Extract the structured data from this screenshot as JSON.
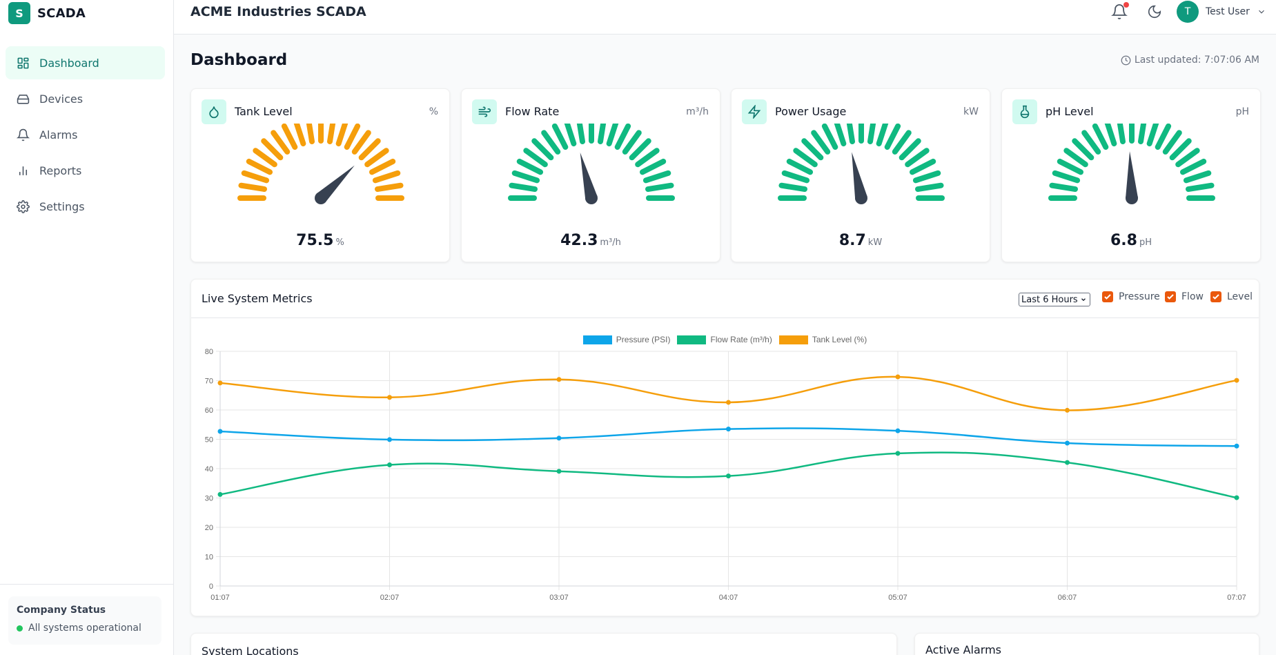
{
  "brand": {
    "logo_letter": "S",
    "name": "SCADA"
  },
  "header": {
    "title": "ACME Industries SCADA",
    "user_initial": "T",
    "user_name": "Test User"
  },
  "sidebar": {
    "items": [
      {
        "label": "Dashboard",
        "icon": "grid-icon",
        "active": true
      },
      {
        "label": "Devices",
        "icon": "hard-drive-icon"
      },
      {
        "label": "Alarms",
        "icon": "bell-icon"
      },
      {
        "label": "Reports",
        "icon": "bar-chart-icon"
      },
      {
        "label": "Settings",
        "icon": "gear-icon"
      }
    ],
    "company_status": {
      "title": "Company Status",
      "text": "All systems operational"
    }
  },
  "page": {
    "title": "Dashboard",
    "last_updated": "Last updated: 7:07:06 AM"
  },
  "gauges": [
    {
      "title": "Tank Level",
      "unit_label": "%",
      "value": "75.5",
      "value_unit": "%",
      "fraction": 0.755,
      "color": "#f59e0b",
      "icon": "droplet-icon"
    },
    {
      "title": "Flow Rate",
      "unit_label": "m³/h",
      "value": "42.3",
      "value_unit": "m³/h",
      "fraction": 0.423,
      "color": "#10b981",
      "icon": "wind-icon"
    },
    {
      "title": "Power Usage",
      "unit_label": "kW",
      "value": "8.7",
      "value_unit": "kW",
      "fraction": 0.435,
      "color": "#10b981",
      "icon": "zap-icon"
    },
    {
      "title": "pH Level",
      "unit_label": "pH",
      "value": "6.8",
      "value_unit": "pH",
      "fraction": 0.486,
      "color": "#10b981",
      "icon": "flask-icon"
    }
  ],
  "metrics": {
    "title": "Live System Metrics",
    "range_selected": "Last 6 Hours",
    "toggles": [
      "Pressure",
      "Flow",
      "Level"
    ]
  },
  "chart_data": {
    "type": "line",
    "x": [
      "01:07",
      "02:07",
      "03:07",
      "04:07",
      "05:07",
      "06:07",
      "07:07"
    ],
    "ylim": [
      0,
      80
    ],
    "yticks": [
      "0",
      "10",
      "20",
      "30",
      "40",
      "50",
      "60",
      "70",
      "80"
    ],
    "grid": true,
    "legend_position": "top",
    "series": [
      {
        "name": "Pressure (PSI)",
        "color": "#0ea5e9",
        "values": [
          52.7,
          49.9,
          50.4,
          53.5,
          52.9,
          48.7,
          47.7
        ]
      },
      {
        "name": "Flow Rate (m³/h)",
        "color": "#10b981",
        "values": [
          31.2,
          41.3,
          39.1,
          37.5,
          45.2,
          42.1,
          30.1
        ]
      },
      {
        "name": "Tank Level (%)",
        "color": "#f59e0b",
        "values": [
          69.2,
          64.3,
          70.4,
          62.6,
          71.3,
          59.9,
          70.1
        ]
      }
    ]
  },
  "bottom": {
    "locations_title": "System Locations",
    "alarms_title": "Active Alarms"
  }
}
